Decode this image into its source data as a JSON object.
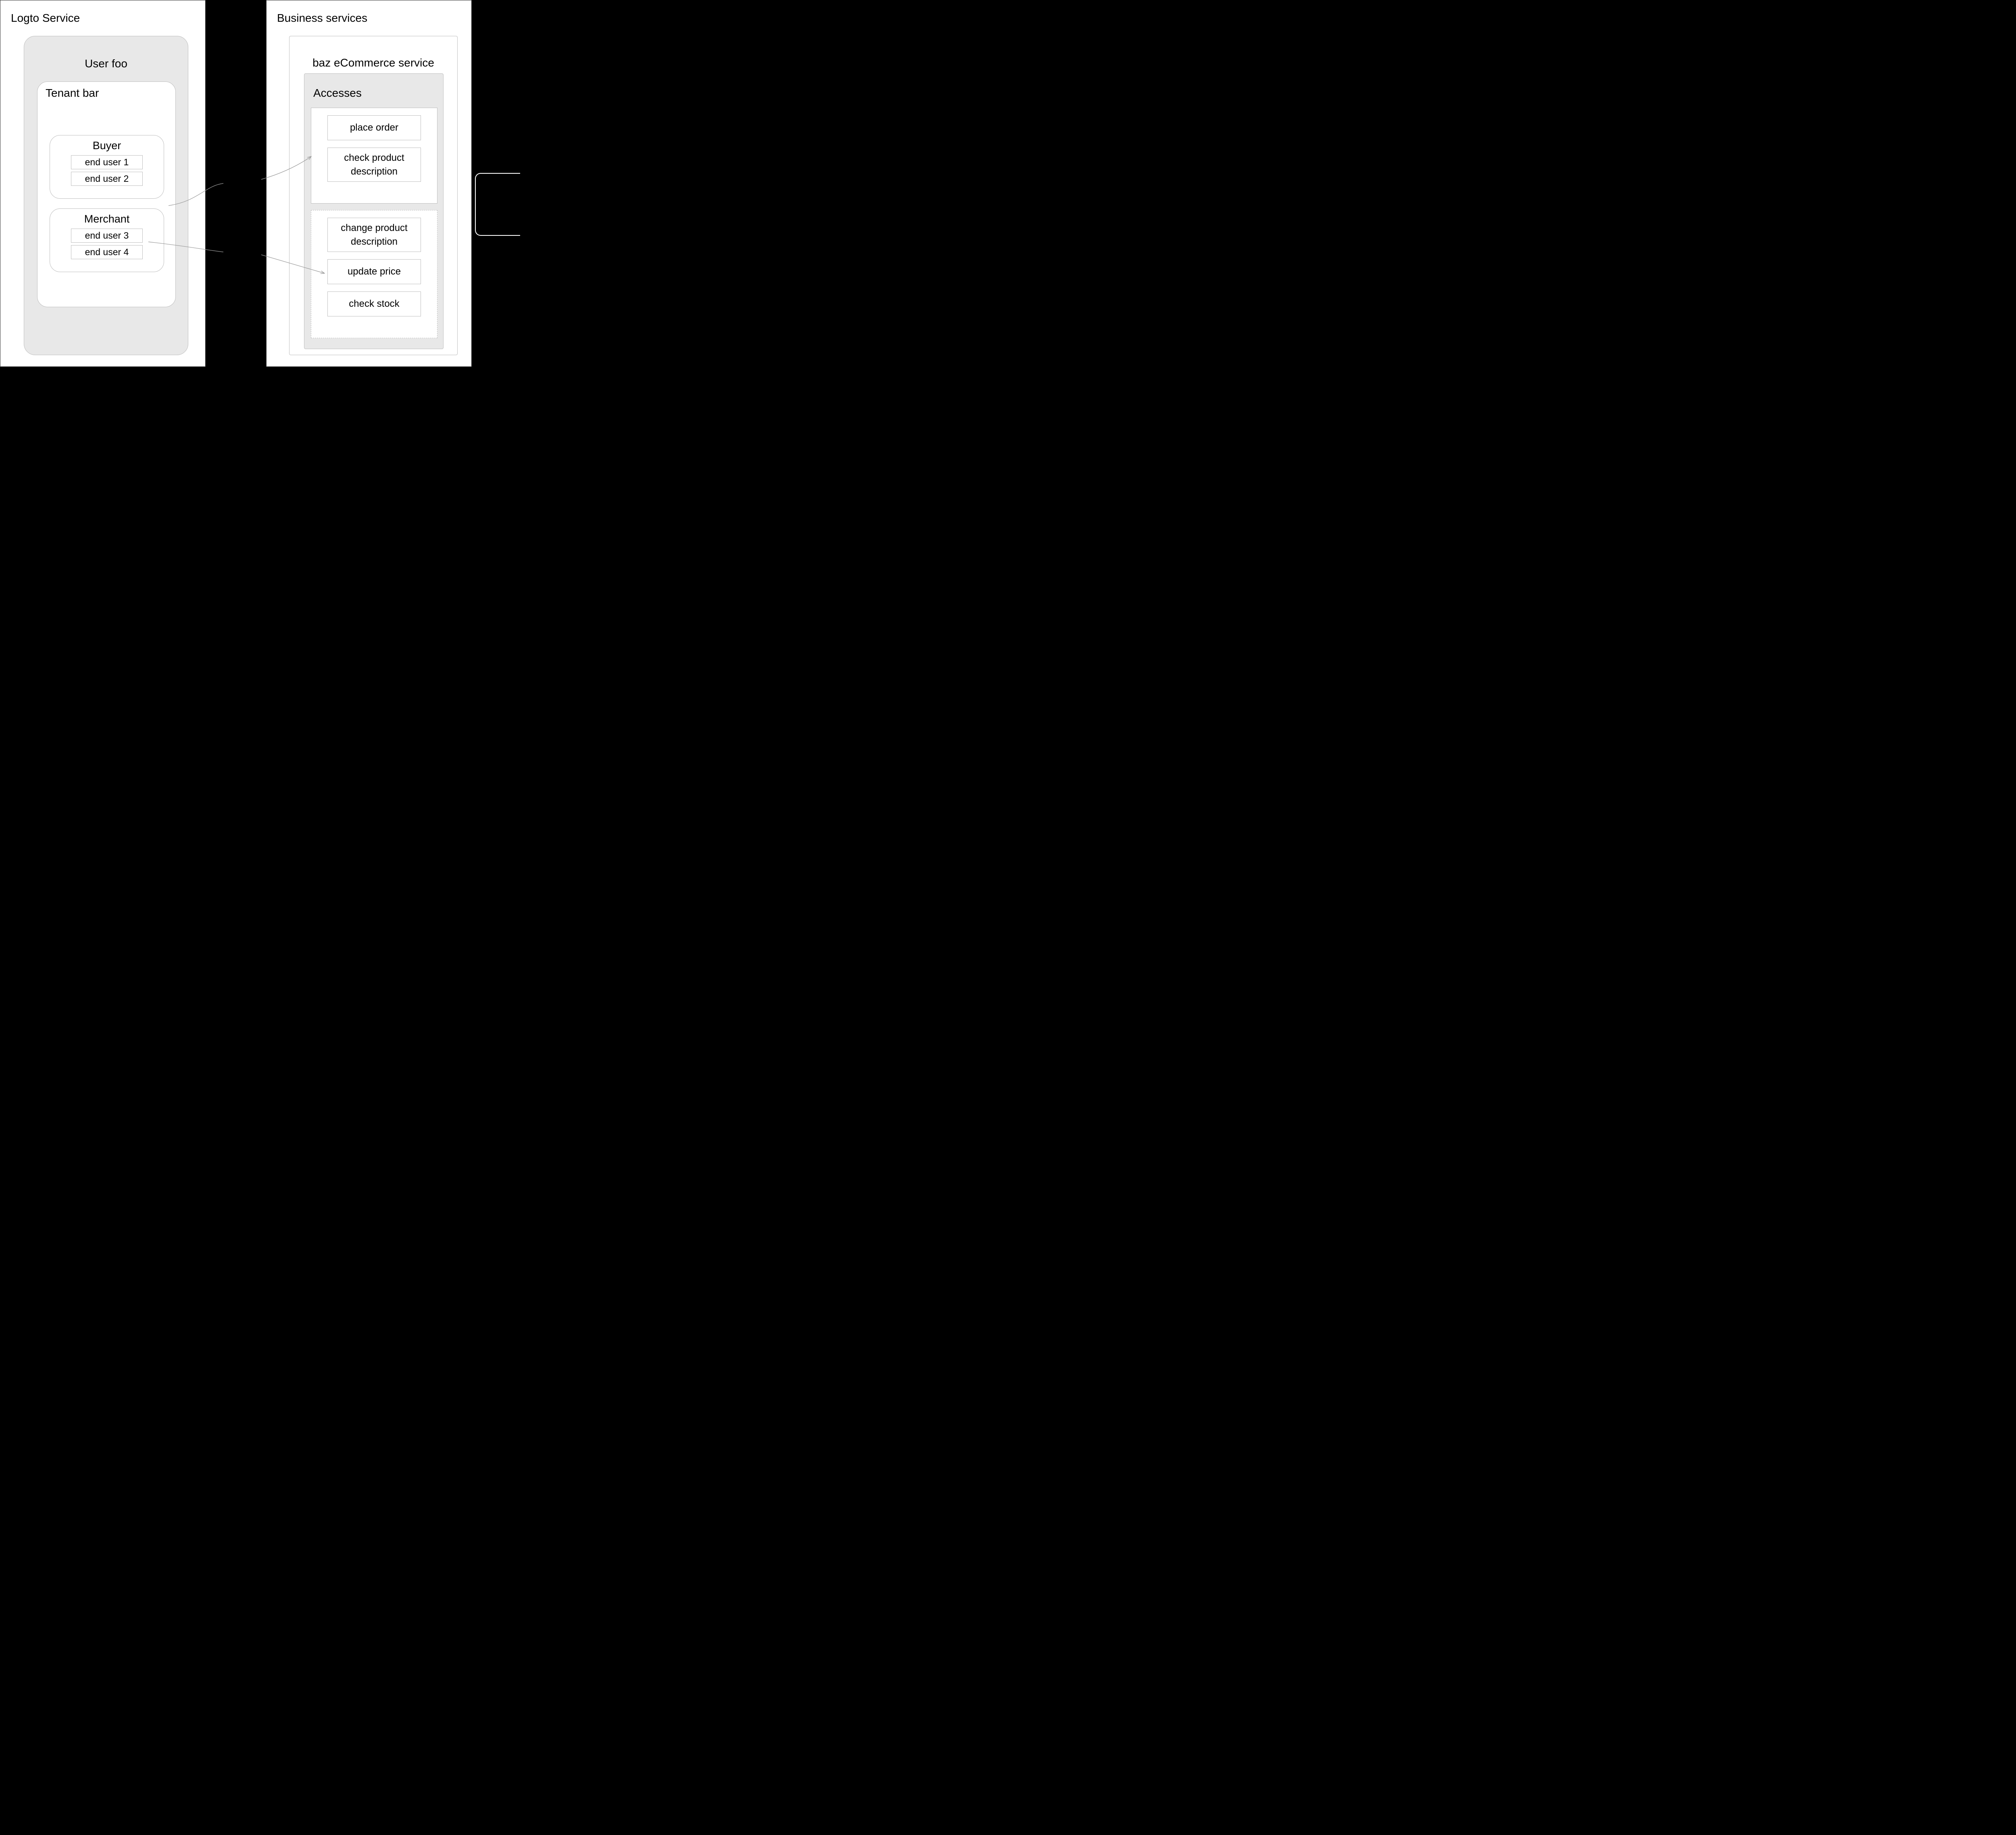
{
  "left_panel": {
    "title": "Logto Service",
    "user_box": {
      "title": "User foo",
      "tenant": {
        "title": "Tenant bar",
        "roles": [
          {
            "name": "Buyer",
            "users": [
              "end user 1",
              "end user 2"
            ]
          },
          {
            "name": "Merchant",
            "users": [
              "end user 3",
              "end user 4"
            ]
          }
        ]
      }
    }
  },
  "right_panel": {
    "title": "Business services",
    "service": {
      "title": "baz eCommerce service",
      "accesses": {
        "title": "Accesses",
        "group_a": [
          "place order",
          "check product description"
        ],
        "group_b": [
          "change product description",
          "update price",
          "check stock"
        ]
      }
    }
  }
}
